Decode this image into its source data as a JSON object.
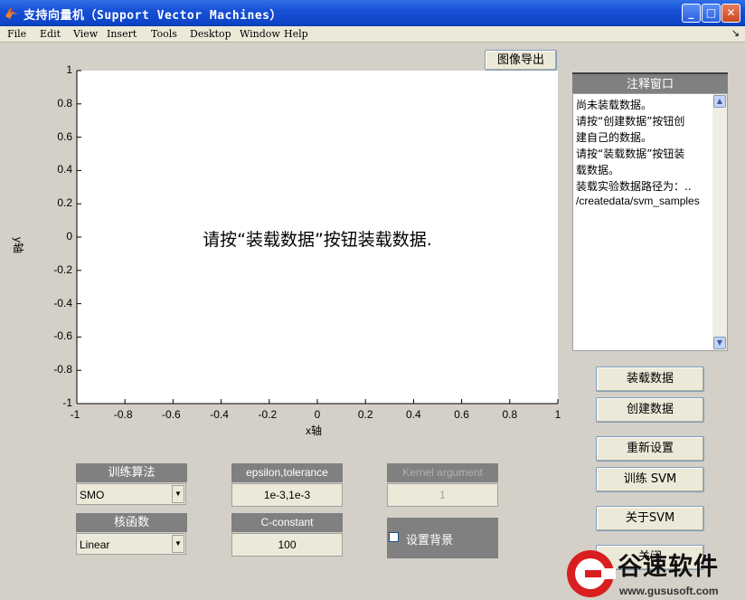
{
  "window": {
    "title": "支持向量机（Support Vector Machines）",
    "minimize": "_",
    "maximize": "□",
    "close": "✕"
  },
  "menu": [
    "File",
    "Edit",
    "View",
    "Insert",
    "Tools",
    "Desktop",
    "Window",
    "Help"
  ],
  "menu_arrow": "↘",
  "export_button": "图像导出",
  "axes": {
    "ticks": [
      "-1",
      "-0.8",
      "-0.6",
      "-0.4",
      "-0.2",
      "0",
      "0.2",
      "0.4",
      "0.6",
      "0.8",
      "1"
    ],
    "xlabel": "x轴",
    "ylabel": "y轴",
    "message": "请按“装载数据”按钮装载数据."
  },
  "notes": {
    "header": "注释窗口",
    "lines": [
      "尚未装载数据。",
      "请按“创建数据”按钮创",
      "建自己的数据。",
      "请按“装载数据”按钮装",
      "载数据。",
      "装载实验数据路径为：..",
      "/createdata/svm_samples"
    ]
  },
  "buttons": {
    "load": "装载数据",
    "create": "创建数据",
    "reset": "重新设置",
    "train": "训练 SVM",
    "about": "关于SVM",
    "close": "关闭"
  },
  "params": {
    "algorithm_label": "训练算法",
    "algorithm_value": "SMO",
    "kernel_label": "核函数",
    "kernel_value": "Linear",
    "eps_label": "epsilon,tolerance",
    "eps_value": "1e-3,1e-3",
    "c_label": "C-constant",
    "c_value": "100",
    "karg_label": "Kernel argument",
    "karg_value": "1",
    "background_label": "设置背景"
  },
  "watermark": {
    "title": "谷速软件",
    "url": "www.gususoft.com"
  }
}
